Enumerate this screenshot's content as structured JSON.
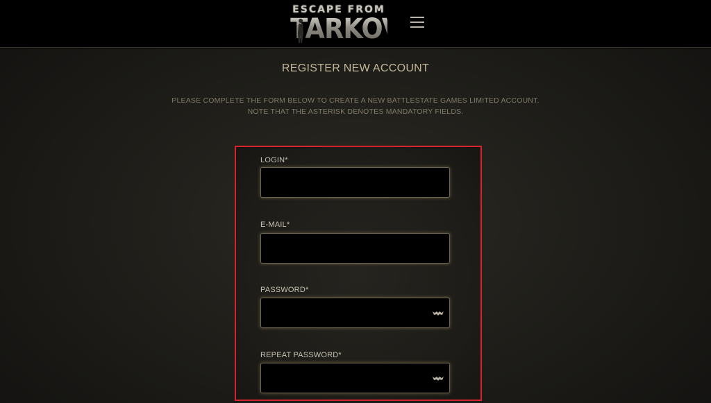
{
  "header": {
    "logo": {
      "line1": "ESCAPE FROM",
      "line2": "TARKOV"
    },
    "menu_icon": "hamburger-menu-icon"
  },
  "page": {
    "title": "REGISTER NEW ACCOUNT",
    "description_line1": "PLEASE COMPLETE THE FORM BELOW TO CREATE A NEW BATTLESTATE GAMES LIMITED ACCOUNT.",
    "description_line2": "NOTE THAT THE ASTERISK DENOTES MANDATORY FIELDS."
  },
  "form": {
    "login": {
      "label": "LOGIN*",
      "value": ""
    },
    "email": {
      "label": "E-MAIL*",
      "value": ""
    },
    "password": {
      "label": "PASSWORD*",
      "value": "",
      "icon": "eye-icon"
    },
    "repeat_password": {
      "label": "REPEAT PASSWORD*",
      "value": "",
      "icon": "eye-icon"
    }
  },
  "colors": {
    "header_bg": "#000000",
    "page_bg": "#1b1a17",
    "title": "#c2b79a",
    "description": "#807a6a",
    "label": "#c7c2b4",
    "input_bg": "#000000",
    "input_border": "#6e6552",
    "highlight_box": "#d8222d"
  }
}
